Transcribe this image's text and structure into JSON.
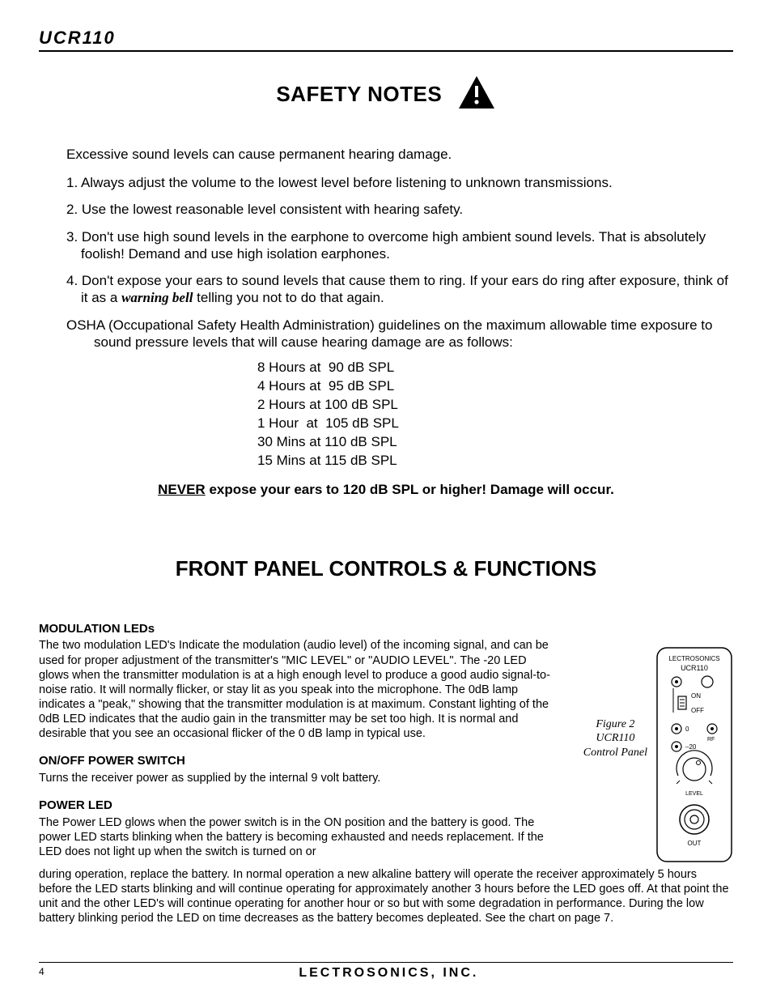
{
  "header": {
    "model": "UCR110"
  },
  "safety": {
    "title": "SAFETY NOTES",
    "intro": "Excessive sound levels can cause permanent hearing damage.",
    "items": [
      "1. Always adjust the volume to the lowest level before listening to unknown transmissions.",
      "2. Use the lowest reasonable level consistent with hearing safety.",
      "3. Don't use high sound levels in the earphone to overcome high ambient sound levels.  That is absolutely foolish!  Demand and use high isolation earphones.",
      "4. Don't expose your ears to sound levels that cause them to ring.  If your ears do ring after exposure, think of it as a "
    ],
    "item4_emph": "warning bell",
    "item4_tail": " telling you not to do that again.",
    "osha_lead": "OSHA (Occupational Safety Health Administration) guidelines on the maximum allowable time exposure to sound pressure levels that will cause hearing damage are as follows:",
    "spl_rows": [
      "8 Hours at  90 dB SPL",
      "4 Hours at  95 dB SPL",
      "2 Hours at 100 dB SPL",
      "1 Hour  at  105 dB SPL",
      "30 Mins at 110 dB SPL",
      "15 Mins at 115 dB SPL"
    ],
    "never_u": "NEVER",
    "never_rest": " expose your ears to 120 dB SPL or higher!  Damage will occur."
  },
  "controls": {
    "title": "FRONT PANEL CONTROLS & FUNCTIONS",
    "modulation": {
      "heading": "MODULATION LEDs",
      "body": "The two modulation LED's Indicate the modulation (audio level) of the incoming signal, and can be used for proper adjustment of the transmitter's \"MIC LEVEL\" or \"AUDIO LEVEL\".   The -20 LED glows when the transmitter modulation is at a high enough level to produce a good audio signal-to-noise ratio. It will normally flicker, or stay lit as you speak into the microphone. The 0dB lamp indicates a \"peak,\" showing that the transmitter modulation is at maximum. Constant lighting of the 0dB LED indicates that the audio gain in the transmitter may be set too high. It is normal and desirable that you see an occasional flicker of the 0 dB lamp in typical use."
    },
    "power_switch": {
      "heading": "ON/OFF POWER  SWITCH",
      "body": "Turns the receiver power as supplied by the internal 9 volt battery."
    },
    "power_led": {
      "heading": "POWER LED",
      "body_short": "The Power LED glows when the power switch is in the ON position and the battery is good.   The power LED starts blinking when the battery is becoming exhausted and needs replacement.  If the LED  does not light up when the switch is turned on or",
      "body_wrap": "during operation, replace the battery.  In normal operation a new alkaline battery will operate the receiver approximately 5 hours before the LED starts blinking and will continue operating for approximately another 3 hours before the LED goes off.  At that point the unit and the other LED's will continue operating for another hour or so but with some degradation in performance.  During the low battery blinking period the LED on time decreases as the battery becomes depleated.  See the chart on page 7."
    },
    "figure": {
      "line1": "Figure 2",
      "line2": "UCR110",
      "line3": "Control Panel",
      "panel": {
        "brand": "LECTROSONICS",
        "model": "UCR110",
        "on": "ON",
        "off": "OFF",
        "zero": "0",
        "neg20": "–20",
        "rf": "RF",
        "level": "LEVEL",
        "out": "OUT"
      }
    }
  },
  "footer": {
    "page": "4",
    "brand": "LECTROSONICS, INC."
  }
}
